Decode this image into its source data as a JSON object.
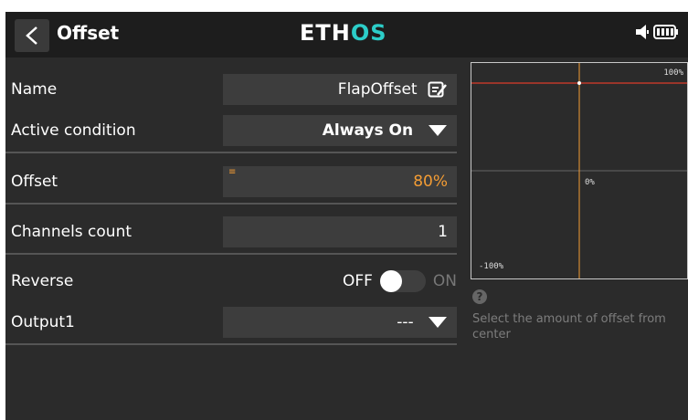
{
  "header": {
    "title": "Offset",
    "logo_left": "ETH",
    "logo_accent": "OS"
  },
  "form": {
    "name": {
      "label": "Name",
      "value": "FlapOffset"
    },
    "active_condition": {
      "label": "Active condition",
      "value": "Always On"
    },
    "offset": {
      "label": "Offset",
      "value": "80%",
      "marker": "≡"
    },
    "channels_count": {
      "label": "Channels count",
      "value": "1"
    },
    "reverse": {
      "label": "Reverse",
      "off_label": "OFF",
      "on_label": "ON",
      "state": "off"
    },
    "output1": {
      "label": "Output1",
      "value": "---"
    }
  },
  "graph": {
    "top_label": "100%",
    "center_label": "0%",
    "bottom_label": "-100%",
    "offset_percent": 80
  },
  "help": {
    "icon": "?",
    "text": "Select the amount of offset from center"
  },
  "colors": {
    "accent_orange": "#f39c34",
    "logo_teal": "#2ccdc8",
    "curve_red": "#c0392b"
  },
  "icons": [
    "chevron-left-icon",
    "speaker-icon",
    "battery-icon",
    "edit-icon",
    "dropdown-arrow-icon",
    "help-icon"
  ]
}
